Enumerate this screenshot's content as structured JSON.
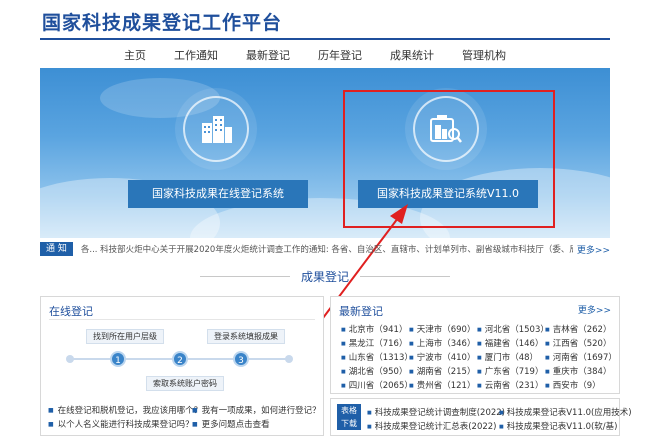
{
  "header": {
    "site_title": "国家科技成果登记工作平台",
    "nav": [
      "主页",
      "工作通知",
      "最新登记",
      "历年登记",
      "成果统计",
      "管理机构"
    ]
  },
  "banner": {
    "left_button": "国家科技成果在线登记系统",
    "right_button": "国家科技成果登记系统V11.0"
  },
  "notice": {
    "tag": "通 知",
    "text": "各...      科技部火炬中心关于开展2020年度火炬统计调查工作的通知: 各省、自治区、直辖市、计划单列市、副省级城市科技厅（委、局），新疆生产建设兵团科技局：各",
    "more": "更多>>"
  },
  "section": {
    "title": "成果登记"
  },
  "online": {
    "title": "在线登记",
    "steps": {
      "s1": "1",
      "s2": "2",
      "s3": "3"
    },
    "labels": {
      "find": "找到所在用户层级",
      "login": "登录系统填报成果",
      "account": "索取系统账户密码"
    },
    "faq": [
      "在线登记和脱机登记，我应该用哪个？",
      "我有一项成果，如何进行登记？",
      "以个人名义能进行科技成果登记吗？",
      "更多问题点击查看"
    ]
  },
  "latest": {
    "title": "最新登记",
    "more": "更多>>",
    "regions": [
      "北京市（941）",
      "天津市（690）",
      "河北省（1503）",
      "吉林省（262）",
      "黑龙江（716）",
      "上海市（346）",
      "福建省（146）",
      "江西省（520）",
      "山东省（1313）",
      "宁波市（410）",
      "厦门市（48）",
      "河南省（1697）",
      "湖北省（950）",
      "湖南省（215）",
      "广东省（719）",
      "重庆市（384）",
      "四川省（2065）",
      "贵州省（121）",
      "云南省（231）",
      "西安市（9）"
    ]
  },
  "forms": {
    "tag_line1": "表格",
    "tag_line2": "下载",
    "links": [
      "科技成果登记统计调查制度(2022)",
      "科技成果登记表V11.0(应用技术)",
      "科技成果登记统计汇总表(2022)",
      "科技成果登记表V11.0(软/基)"
    ]
  },
  "colors": {
    "brand": "#1f4f9c",
    "accent": "#2a76b9",
    "highlight": "#e02020"
  }
}
